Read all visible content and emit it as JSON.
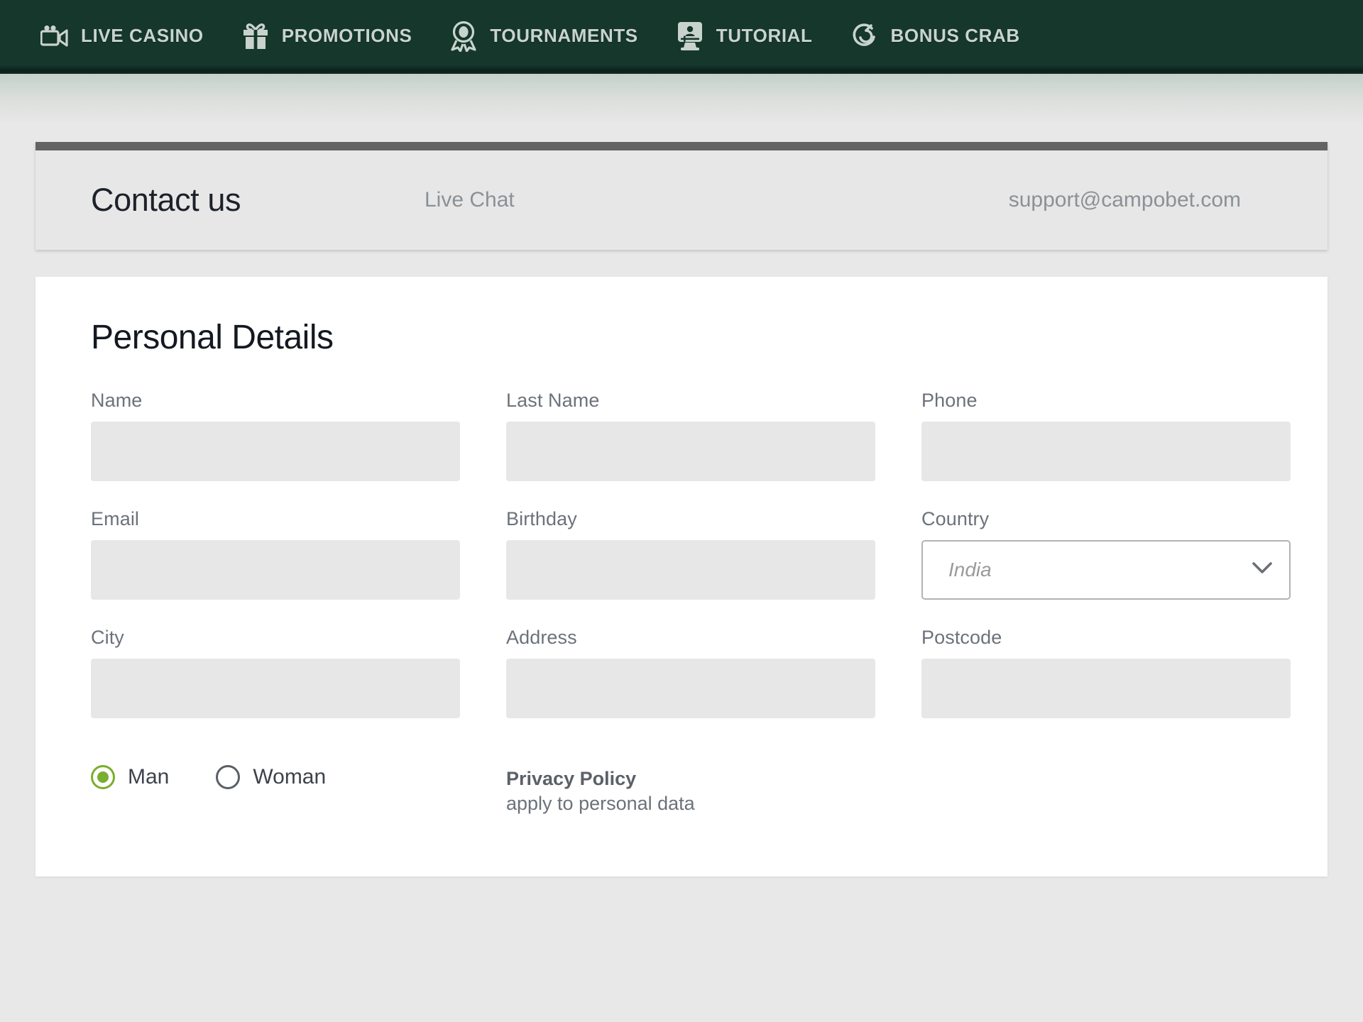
{
  "nav": {
    "items": [
      {
        "label": "LIVE CASINO",
        "icon": "video-camera-icon"
      },
      {
        "label": "PROMOTIONS",
        "icon": "gift-icon"
      },
      {
        "label": "TOURNAMENTS",
        "icon": "award-medal-icon"
      },
      {
        "label": "TUTORIAL",
        "icon": "monitor-person-icon"
      },
      {
        "label": "BONUS CRAB",
        "icon": "crab-spiral-icon"
      }
    ]
  },
  "contact": {
    "title": "Contact us",
    "live_chat": "Live Chat",
    "email": "support@campobet.com"
  },
  "form": {
    "title": "Personal Details",
    "fields": [
      {
        "label": "Name",
        "value": "",
        "type": "text"
      },
      {
        "label": "Last Name",
        "value": "",
        "type": "text"
      },
      {
        "label": "Phone",
        "value": "",
        "type": "text"
      },
      {
        "label": "Email",
        "value": "",
        "type": "text"
      },
      {
        "label": "Birthday",
        "value": "",
        "type": "text"
      },
      {
        "label": "Country",
        "value": "India",
        "type": "select"
      },
      {
        "label": "City",
        "value": "",
        "type": "text"
      },
      {
        "label": "Address",
        "value": "",
        "type": "text"
      },
      {
        "label": "Postcode",
        "value": "",
        "type": "text"
      }
    ],
    "gender": {
      "options": [
        {
          "label": "Man",
          "selected": true
        },
        {
          "label": "Woman",
          "selected": false
        }
      ]
    },
    "privacy": {
      "title": "Privacy Policy",
      "subtitle": "apply to personal data"
    }
  },
  "colors": {
    "nav_background": "#15372c",
    "nav_text": "#c9d3cd",
    "page_background": "#e8e8e8",
    "card_background": "#ffffff",
    "panel_background": "#e7e7e7",
    "panel_top_bar": "#636363",
    "input_fill": "#e7e7e7",
    "accent_green": "#79ae2e",
    "label_text": "#6c727a",
    "muted_text": "#8b9196"
  }
}
